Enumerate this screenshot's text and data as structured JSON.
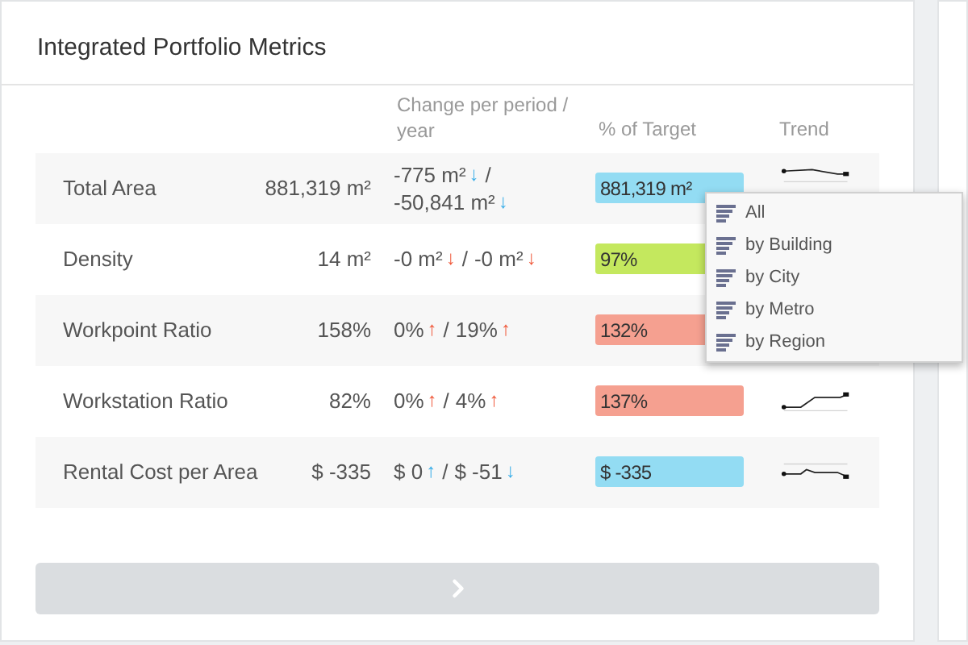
{
  "title": "Integrated Portfolio Metrics",
  "columns": {
    "change": "Change per period / year",
    "target": "% of Target",
    "trend": "Trend"
  },
  "rows": [
    {
      "label": "Total Area",
      "value": "881,319 m²",
      "change": [
        {
          "text": "-775 m²",
          "arrow": "↓",
          "color": "#3aaee8"
        },
        {
          "text": "/"
        },
        {
          "text": "-50,841 m²",
          "arrow": "↓",
          "color": "#3aaee8"
        }
      ],
      "target": {
        "text": "881,319 m²",
        "color": "#93dcf3"
      }
    },
    {
      "label": "Density",
      "value": "14 m²",
      "change": [
        {
          "text": "-0 m²",
          "arrow": "↓",
          "color": "#f05a3c"
        },
        {
          "text": "/"
        },
        {
          "text": "-0 m²",
          "arrow": "↓",
          "color": "#f05a3c"
        }
      ],
      "target": {
        "text": "97%",
        "color": "#c4e85e"
      }
    },
    {
      "label": "Workpoint Ratio",
      "value": "158%",
      "change": [
        {
          "text": "0%",
          "arrow": "↑",
          "color": "#f05a3c"
        },
        {
          "text": "/"
        },
        {
          "text": "19%",
          "arrow": "↑",
          "color": "#f05a3c"
        }
      ],
      "target": {
        "text": "132%",
        "color": "#f5a090"
      }
    },
    {
      "label": "Workstation Ratio",
      "value": "82%",
      "change": [
        {
          "text": "0%",
          "arrow": "↑",
          "color": "#f05a3c"
        },
        {
          "text": "/"
        },
        {
          "text": "4%",
          "arrow": "↑",
          "color": "#f05a3c"
        }
      ],
      "target": {
        "text": "137%",
        "color": "#f5a090"
      }
    },
    {
      "label": "Rental Cost per Area",
      "value": "$ -335",
      "change": [
        {
          "text": "$ 0",
          "arrow": "↑",
          "color": "#3aaee8"
        },
        {
          "text": "/"
        },
        {
          "text": "$ -51",
          "arrow": "↓",
          "color": "#3aaee8"
        }
      ],
      "target": {
        "text": "$ -335",
        "color": "#93dcf3"
      }
    }
  ],
  "menu": [
    "All",
    "by Building",
    "by City",
    "by Metro",
    "by Region"
  ]
}
